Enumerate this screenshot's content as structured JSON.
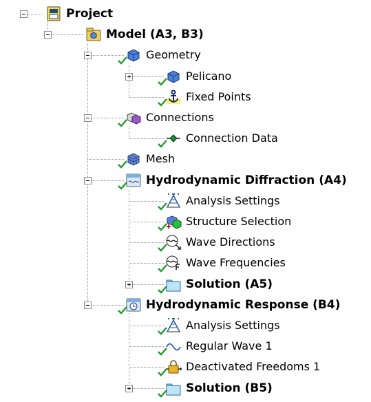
{
  "tree": [
    {
      "id": "project",
      "label": "Project",
      "bold": true,
      "icon": "project-icon",
      "level": 0,
      "expander": "minus",
      "check": false
    },
    {
      "id": "model",
      "label": "Model (A3, B3)",
      "bold": true,
      "icon": "model-icon",
      "level": 1,
      "expander": "minus",
      "check": false
    },
    {
      "id": "geometry",
      "label": "Geometry",
      "bold": false,
      "icon": "geometry-icon",
      "level": 2,
      "expander": "minus",
      "check": true
    },
    {
      "id": "pelicano",
      "label": "Pelicano",
      "bold": false,
      "icon": "geometry-body-icon",
      "level": 3,
      "expander": "plus",
      "check": true
    },
    {
      "id": "fixed-points",
      "label": "Fixed Points",
      "bold": false,
      "icon": "anchor-icon",
      "level": 3,
      "expander": null,
      "check": true
    },
    {
      "id": "connections",
      "label": "Connections",
      "bold": false,
      "icon": "connections-icon",
      "level": 2,
      "expander": "minus",
      "check": true
    },
    {
      "id": "connection-data",
      "label": "Connection Data",
      "bold": false,
      "icon": "connection-data-icon",
      "level": 3,
      "expander": null,
      "check": true
    },
    {
      "id": "mesh",
      "label": "Mesh",
      "bold": false,
      "icon": "mesh-icon",
      "level": 2,
      "expander": null,
      "check": true
    },
    {
      "id": "hydro-diffraction",
      "label": "Hydrodynamic Diffraction (A4)",
      "bold": true,
      "icon": "diffraction-icon",
      "level": 2,
      "expander": "minus",
      "check": true
    },
    {
      "id": "analysis-settings-a",
      "label": "Analysis Settings",
      "bold": false,
      "icon": "analysis-settings-icon",
      "level": 3,
      "expander": null,
      "check": true
    },
    {
      "id": "structure-selection",
      "label": "Structure Selection",
      "bold": false,
      "icon": "structure-selection-icon",
      "level": 3,
      "expander": null,
      "check": true
    },
    {
      "id": "wave-directions",
      "label": "Wave Directions",
      "bold": false,
      "icon": "wave-directions-icon",
      "level": 3,
      "expander": null,
      "check": true
    },
    {
      "id": "wave-frequencies",
      "label": "Wave Frequencies",
      "bold": false,
      "icon": "wave-frequencies-icon",
      "level": 3,
      "expander": null,
      "check": true
    },
    {
      "id": "solution-a5",
      "label": "Solution (A5)",
      "bold": true,
      "icon": "solution-folder-icon",
      "level": 3,
      "expander": "plus",
      "check": true
    },
    {
      "id": "hydro-response",
      "label": "Hydrodynamic Response (B4)",
      "bold": true,
      "icon": "response-icon",
      "level": 2,
      "expander": "minus",
      "check": true
    },
    {
      "id": "analysis-settings-b",
      "label": "Analysis Settings",
      "bold": false,
      "icon": "analysis-settings-icon",
      "level": 3,
      "expander": null,
      "check": true
    },
    {
      "id": "regular-wave",
      "label": "Regular Wave 1",
      "bold": false,
      "icon": "regular-wave-icon",
      "level": 3,
      "expander": null,
      "check": true
    },
    {
      "id": "deactivated-freedoms",
      "label": "Deactivated Freedoms 1",
      "bold": false,
      "icon": "lock-icon",
      "level": 3,
      "expander": null,
      "check": true
    },
    {
      "id": "solution-b5",
      "label": "Solution (B5)",
      "bold": true,
      "icon": "solution-folder-icon",
      "level": 3,
      "expander": "plus",
      "check": true
    }
  ]
}
